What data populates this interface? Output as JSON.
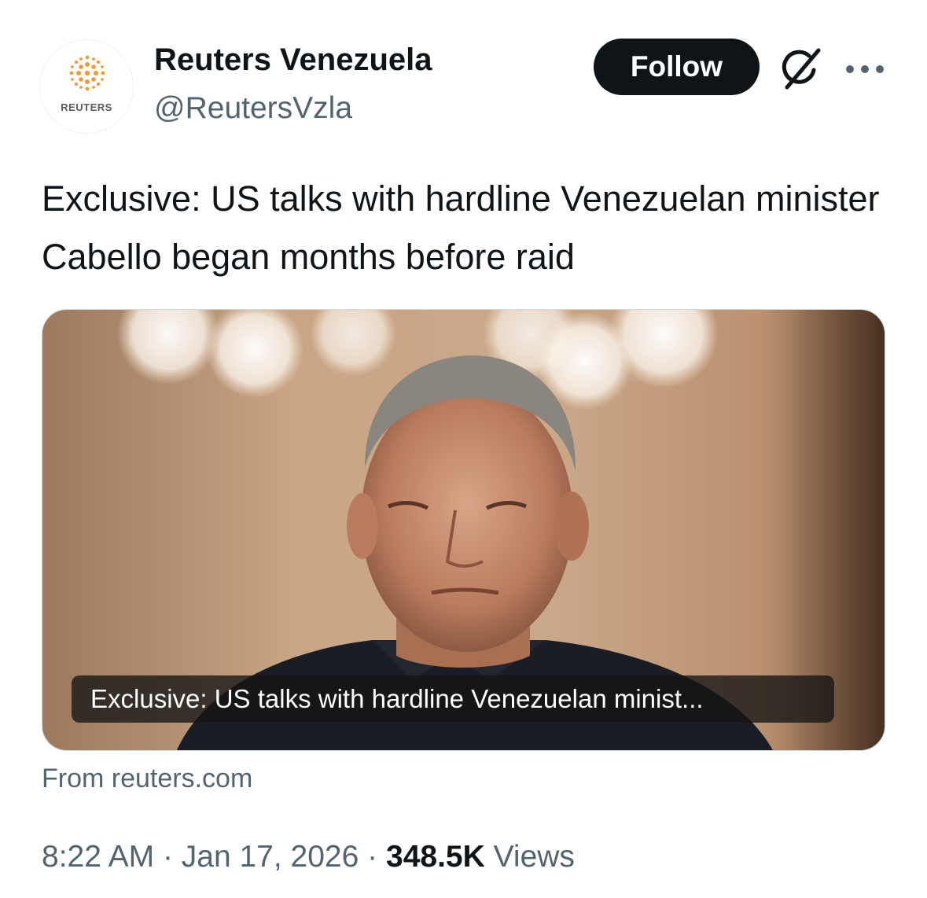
{
  "author": {
    "display_name": "Reuters Venezuela",
    "handle": "@ReutersVzla",
    "avatar_wordmark": "REUTERS"
  },
  "actions": {
    "follow_label": "Follow",
    "grok_icon": "grok-icon",
    "more_icon": "more-icon"
  },
  "tweet": {
    "text": "Exclusive: US talks with hardline Venezuelan minister Cabello began months before raid"
  },
  "card": {
    "caption": "Exclusive: US talks with hardline Venezuelan minist...",
    "source": "From reuters.com"
  },
  "meta": {
    "time": "8:22 AM",
    "separator": "·",
    "date": "Jan 17, 2026",
    "views_count": "348.5K",
    "views_label": "Views"
  },
  "colors": {
    "text_primary": "#0f1419",
    "text_secondary": "#536471",
    "reuters_orange": "#f5a04a"
  }
}
